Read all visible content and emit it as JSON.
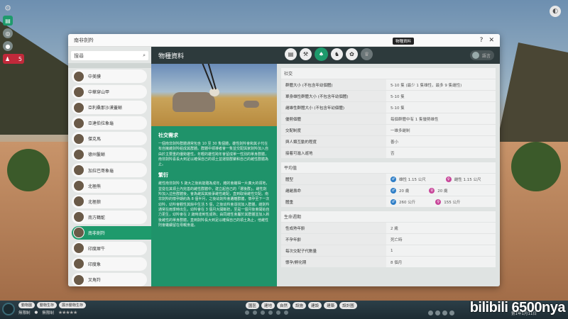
{
  "window": {
    "title": "南非劍羚",
    "help": "?",
    "close": "✕"
  },
  "search": {
    "placeholder": "搜尋"
  },
  "species": [
    {
      "name": "中美貘"
    },
    {
      "name": "中華穿山甲"
    },
    {
      "name": "亞利桑那沙漠蓋蜥"
    },
    {
      "name": "亞達伯拉象龜"
    },
    {
      "name": "傑克馬"
    },
    {
      "name": "德州鬣蜥"
    },
    {
      "name": "加拉巴哥象龜"
    },
    {
      "name": "北極熊"
    },
    {
      "name": "北極狼"
    },
    {
      "name": "南方鶴鴕"
    },
    {
      "name": "南非劍羚",
      "active": true
    },
    {
      "name": "印度犀牛"
    },
    {
      "name": "印度象"
    },
    {
      "name": "叉角羚"
    }
  ],
  "detail": {
    "title": "物種資料",
    "tooltip": "物種資料",
    "tabs": [
      "book-icon",
      "wrench-icon",
      "leaf-icon",
      "animal-icon",
      "paw-icon",
      "trophy-icon"
    ],
    "active_tab": 2,
    "lang_label": "語言"
  },
  "info": {
    "social_heading": "社交需求",
    "social_text": "一個南非劍羚群體通常包含 10 至 30 隻個體，雄性劍羚會和其子代在有自擁雌劍羚組成其群體。群體中領導者會一隻並交配與家劍羚加入自由於主要重的優勢雄性，年輕的雄性跨年會留成單一性別的單身群體，南非劍羚喜長大到足以確保自己的領土並運營群聚和自己的雌性群體為止。",
    "breeding_heading": "繁衍",
    "breeding_text": "雌性南非劍羚 5 歲大之後就能雛為成年，雜的會繼得一片廣大的領地，並從在其領土內完善的雌性群體中，建立起自己的「選後群」。雌性劍羚加入這些群體後，會為雌與其競爭雌性雌配，直到取得雌性交配。南非劍羚的懷孕期約為 8 個半月，之後幼劍羚會遷離群體，懷孕至下一次幼羚，幼羚會觀性其餘中生活 5 個，之後幼羚會尋找加入群體，雌劍羚通常在雨季時出生。幼羚會在 3 個月大開斷奶，至是一個月後會開始自力更生，幼羚會在 2 歲時達到性成熟；由同雌性會屬於其群體並加入新後雌性的單身群體，直到劍羚長大到足以確保自己的領土為止，他雌性則會繼續留在母親身邊。"
  },
  "social_section": {
    "heading": "社交",
    "rows": [
      {
        "k": "群體大小 (不包含年幼個體)",
        "v": "5-10 隻 (最少 1 隻雄性，最多 9 隻雌性)"
      },
      {
        "k": "單身雄性群體大小 (不包含年幼個體)",
        "v": "5-10 隻"
      },
      {
        "k": "雌雄性群體大小 (不包含年幼個體)",
        "v": "5-10 隻"
      },
      {
        "k": "優勢個體",
        "v": "每個群體中有 1 隻優勢雄性"
      },
      {
        "k": "交配制度",
        "v": "一雄多雌制"
      },
      {
        "k": "與人類互動的程度",
        "v": "善小"
      },
      {
        "k": "接着可進入遊地",
        "v": "否"
      }
    ]
  },
  "avg_section": {
    "heading": "平均值",
    "rows": [
      {
        "k": "體型",
        "male": "雄性 1.15 公尺",
        "female": "雌性 1.15 公尺"
      },
      {
        "k": "雌雌壽命",
        "male": "20 歲",
        "female": "20 歲"
      },
      {
        "k": "體重",
        "male": "260 公斤",
        "female": "155 公斤"
      }
    ]
  },
  "life_section": {
    "heading": "生命週期",
    "rows": [
      {
        "k": "性成熟年齡",
        "v": "2 歲"
      },
      {
        "k": "不孕年齡",
        "v": "死亡時"
      },
      {
        "k": "每次交配子代數量",
        "v": "1"
      },
      {
        "k": "懷孕/孵化期",
        "v": "8 個月"
      }
    ]
  },
  "bottom": {
    "chips": [
      "動物園",
      "動物生存",
      "展示動物生存"
    ],
    "budget": "無限制",
    "budget2": "無限制",
    "tools": [
      "園區",
      "建地",
      "自然",
      "設施",
      "建設",
      "建築",
      "設計圖"
    ],
    "date": "第1年1月11日"
  },
  "watermark": "bilibili 6500nya"
}
